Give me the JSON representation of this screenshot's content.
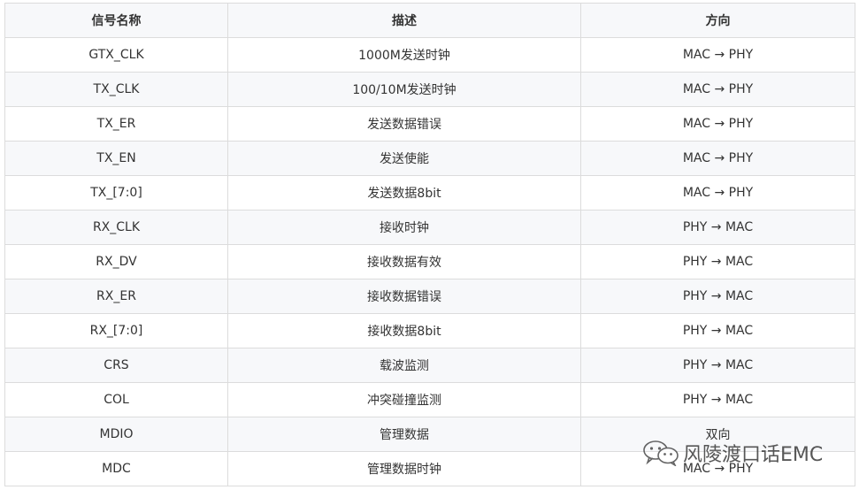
{
  "table": {
    "headers": [
      "信号名称",
      "描述",
      "方向"
    ],
    "rows": [
      {
        "name": "GTX_CLK",
        "desc": "1000M发送时钟",
        "dir": "MAC → PHY"
      },
      {
        "name": "TX_CLK",
        "desc": "100/10M发送时钟",
        "dir": "MAC → PHY"
      },
      {
        "name": "TX_ER",
        "desc": "发送数据错误",
        "dir": "MAC → PHY"
      },
      {
        "name": "TX_EN",
        "desc": "发送使能",
        "dir": "MAC → PHY"
      },
      {
        "name": "TX_[7:0]",
        "desc": "发送数据8bit",
        "dir": "MAC → PHY"
      },
      {
        "name": "RX_CLK",
        "desc": "接收时钟",
        "dir": "PHY → MAC"
      },
      {
        "name": "RX_DV",
        "desc": "接收数据有效",
        "dir": "PHY → MAC"
      },
      {
        "name": "RX_ER",
        "desc": "接收数据错误",
        "dir": "PHY → MAC"
      },
      {
        "name": "RX_[7:0]",
        "desc": "接收数据8bit",
        "dir": "PHY → MAC"
      },
      {
        "name": "CRS",
        "desc": "载波监测",
        "dir": "PHY → MAC"
      },
      {
        "name": "COL",
        "desc": "冲突碰撞监测",
        "dir": "PHY → MAC"
      },
      {
        "name": "MDIO",
        "desc": "管理数据",
        "dir": "双向"
      },
      {
        "name": "MDC",
        "desc": "管理数据时钟",
        "dir": "MAC → PHY"
      }
    ]
  },
  "watermark": {
    "text": "风陵渡口话EMC",
    "icon": "wechat-icon"
  }
}
